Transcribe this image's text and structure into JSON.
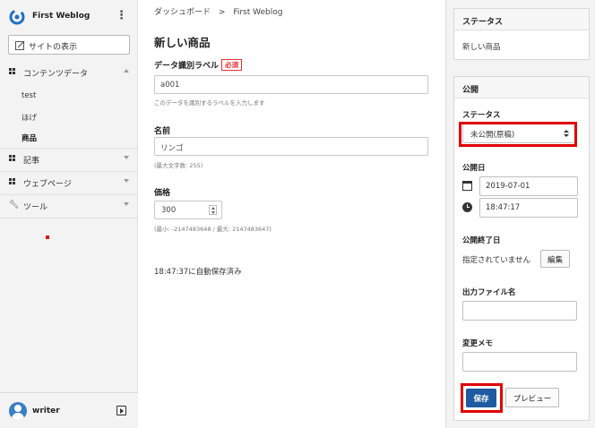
{
  "sidebar": {
    "brand": "First Weblog",
    "view_site": "サイトの表示",
    "sections": [
      {
        "label": "コンテンツデータ",
        "icon": "grid-icon",
        "expanded": true
      },
      {
        "label": "記事",
        "icon": "grid-icon",
        "expanded": false
      },
      {
        "label": "ウェブページ",
        "icon": "grid-icon",
        "expanded": false
      },
      {
        "label": "ツール",
        "icon": "wrench-icon",
        "expanded": false
      }
    ],
    "content_items": [
      "test",
      "ほげ",
      "商品"
    ],
    "active_item": "商品",
    "user": "writer"
  },
  "breadcrumb": {
    "root": "ダッシュボード",
    "separator": ">",
    "current": "First Weblog"
  },
  "main": {
    "title": "新しい商品",
    "label_field": {
      "label": "データ識別ラベル",
      "required": "必須",
      "value": "a001",
      "help": "このデータを識別するラベルを入力します"
    },
    "name_field": {
      "label": "名前",
      "value": "リンゴ",
      "help": "(最大文字数: 255)"
    },
    "price_field": {
      "label": "価格",
      "value": "300",
      "help": "(最小: -2147483648 / 最大: 2147483647)"
    },
    "autosave": "18:47:37に自動保存済み"
  },
  "right": {
    "status_box": {
      "title": "ステータス",
      "value": "新しい商品"
    },
    "publish_box": {
      "title": "公開",
      "status_label": "ステータス",
      "status_value": "未公開(原稿)",
      "publish_date_label": "公開日",
      "date": "2019-07-01",
      "time": "18:47:17",
      "end_label": "公開終了日",
      "end_value": "指定されていません",
      "edit": "編集",
      "file_label": "出力ファイル名",
      "file_value": "",
      "memo_label": "変更メモ",
      "memo_value": "",
      "save": "保存",
      "preview": "プレビュー"
    }
  },
  "colors": {
    "accent": "#1e5aa0",
    "highlight": "#e00000",
    "required": "#e23030"
  }
}
